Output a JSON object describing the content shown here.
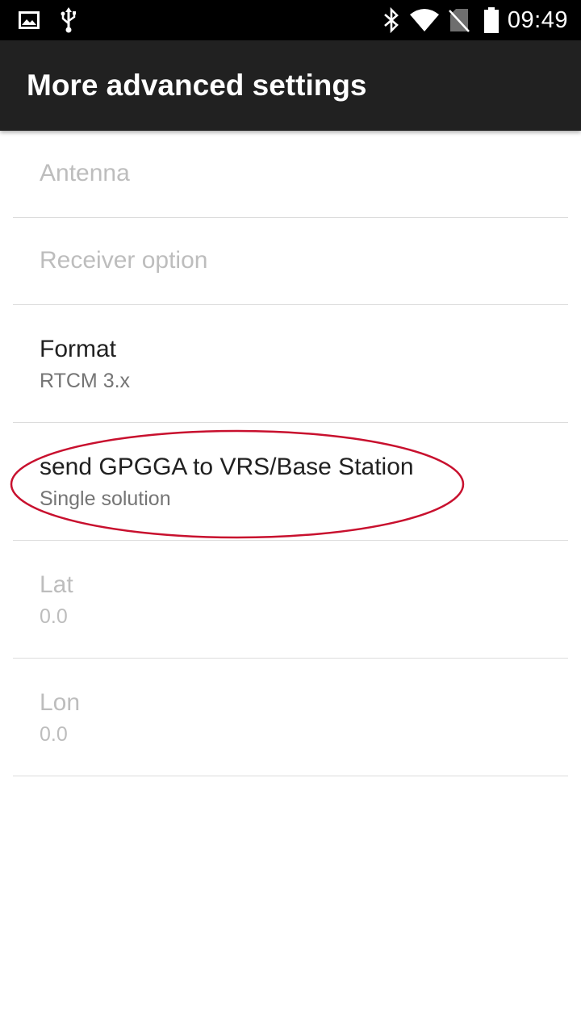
{
  "status_bar": {
    "time": "09:49",
    "left_icons": [
      "image-icon",
      "usb-icon"
    ],
    "right_icons": [
      "bluetooth-icon",
      "wifi-icon",
      "no-sim-icon",
      "battery-icon"
    ]
  },
  "app_bar": {
    "title": "More advanced settings"
  },
  "preferences": [
    {
      "title": "Antenna",
      "summary": "",
      "enabled": false
    },
    {
      "title": "Receiver option",
      "summary": "",
      "enabled": false
    },
    {
      "title": "Format",
      "summary": "RTCM 3.x",
      "enabled": true
    },
    {
      "title": "send GPGGA to VRS/Base Station",
      "summary": "Single solution",
      "enabled": true
    },
    {
      "title": "Lat",
      "summary": "0.0",
      "enabled": false
    },
    {
      "title": "Lon",
      "summary": "0.0",
      "enabled": false
    }
  ],
  "colors": {
    "status_bar_bg": "#000000",
    "app_bar_bg": "#212121",
    "highlight_ellipse": "#c8102e"
  }
}
